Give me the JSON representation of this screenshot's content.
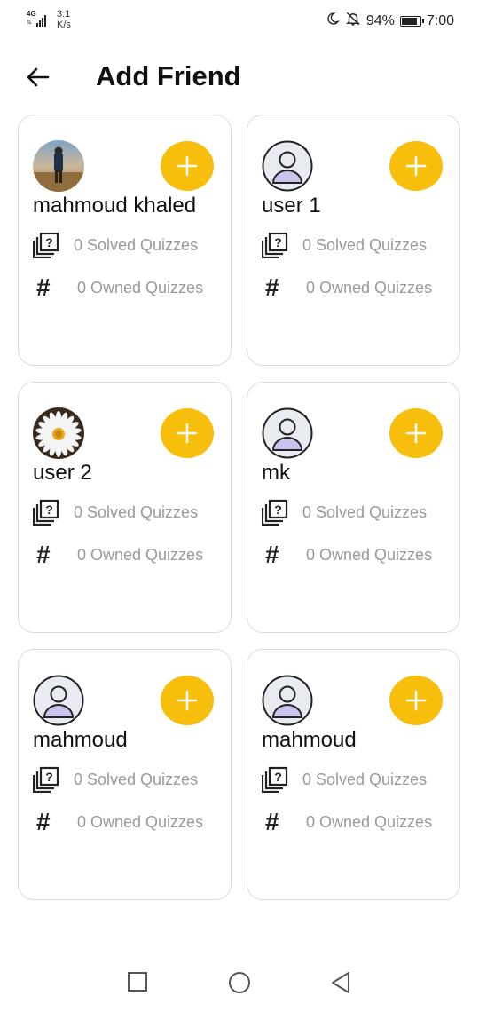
{
  "status_bar": {
    "network": "4G",
    "speed_value": "3.1",
    "speed_unit": "K/s",
    "battery": "94%",
    "time": "7:00",
    "battery_level": 0.94
  },
  "header": {
    "title": "Add Friend"
  },
  "cards": [
    {
      "name": "mahmoud khaled",
      "avatar": "photo-person-field",
      "solved": "0 Solved Quizzes",
      "owned": "0 Owned Quizzes"
    },
    {
      "name": "user 1",
      "avatar": "default-user-icon",
      "solved": "0 Solved Quizzes",
      "owned": "0 Owned Quizzes"
    },
    {
      "name": "user 2",
      "avatar": "photo-daisy-flower",
      "solved": "0 Solved Quizzes",
      "owned": "0 Owned Quizzes"
    },
    {
      "name": "mk",
      "avatar": "default-user-icon",
      "solved": "0 Solved Quizzes",
      "owned": "0 Owned Quizzes"
    },
    {
      "name": "mahmoud",
      "avatar": "default-user-icon",
      "solved": "0 Solved Quizzes",
      "owned": "0 Owned Quizzes"
    },
    {
      "name": "mahmoud",
      "avatar": "default-user-icon",
      "solved": "0 Solved Quizzes",
      "owned": "0 Owned Quizzes"
    }
  ],
  "icons": {
    "back": "arrow-left-icon",
    "add": "plus-icon",
    "solved": "quiz-stack-icon",
    "owned": "hash-icon"
  },
  "colors": {
    "accent": "#F8BE0C",
    "muted_text": "#9a9a9a",
    "card_border": "#dcdcdc",
    "default_avatar_bg": "#e8ecf2",
    "default_avatar_figure": "#c9c3ee"
  }
}
